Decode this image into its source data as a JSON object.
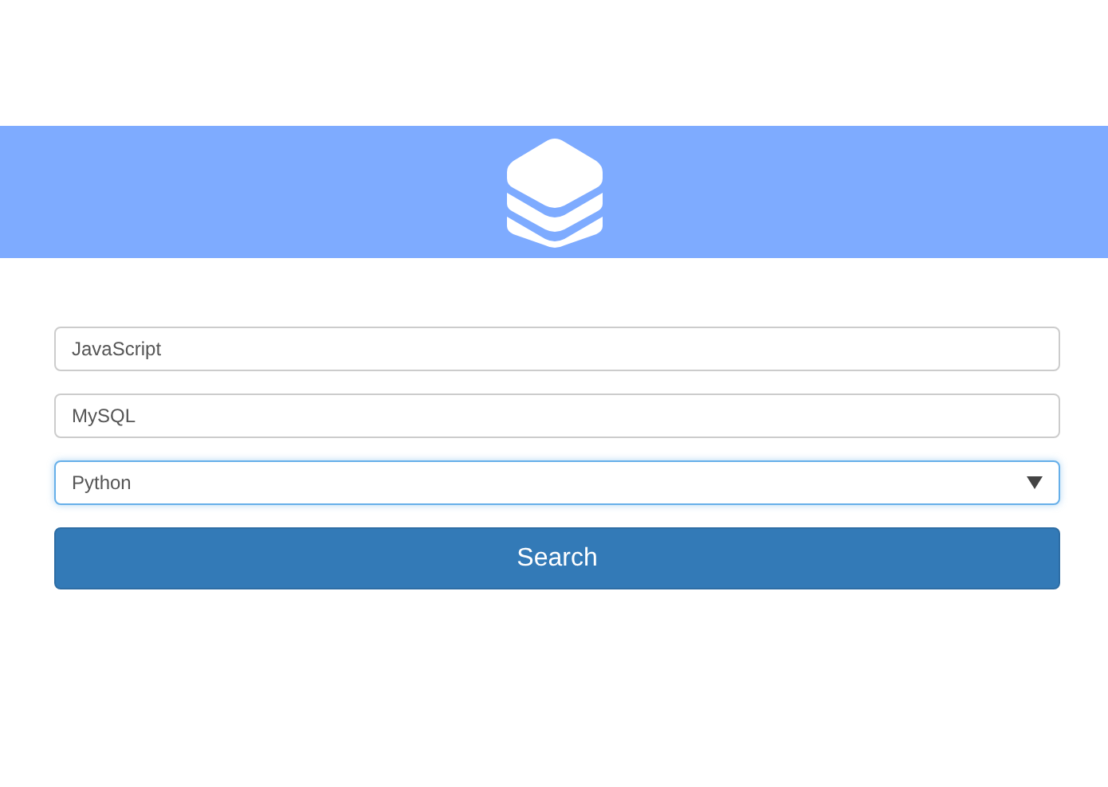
{
  "fields": [
    {
      "kind": "text",
      "value": "JavaScript",
      "focused": false
    },
    {
      "kind": "text",
      "value": "MySQL",
      "focused": false
    },
    {
      "kind": "select",
      "value": "Python",
      "focused": true
    }
  ],
  "search_button": {
    "label": "Search"
  }
}
